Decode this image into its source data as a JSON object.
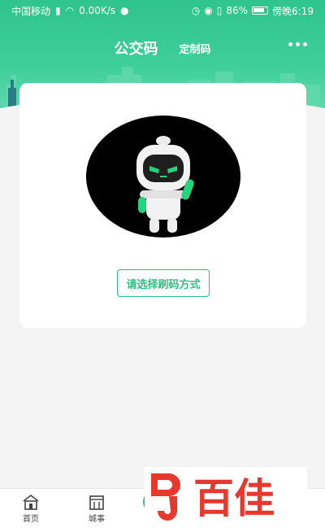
{
  "status_bar": {
    "carrier": "中国移动",
    "network_speed": "0.00K/s",
    "battery": "86%",
    "time": "傍晚6:19"
  },
  "header": {
    "tab_main": "公交码",
    "tab_custom": "定制码",
    "more_icon": "more-dots-icon"
  },
  "card": {
    "select_button_label": "请选择刷码方式",
    "illustration": "robot-mascot"
  },
  "bottom_nav": {
    "items": [
      {
        "label": "首页",
        "icon": "home-icon"
      },
      {
        "label": "城事",
        "icon": "city-icon"
      }
    ]
  },
  "watermark": {
    "text": "百佳"
  },
  "colors": {
    "brand_green": "#2fbf83",
    "header_green": "#3fcf9c",
    "background": "#f4f4f4"
  }
}
